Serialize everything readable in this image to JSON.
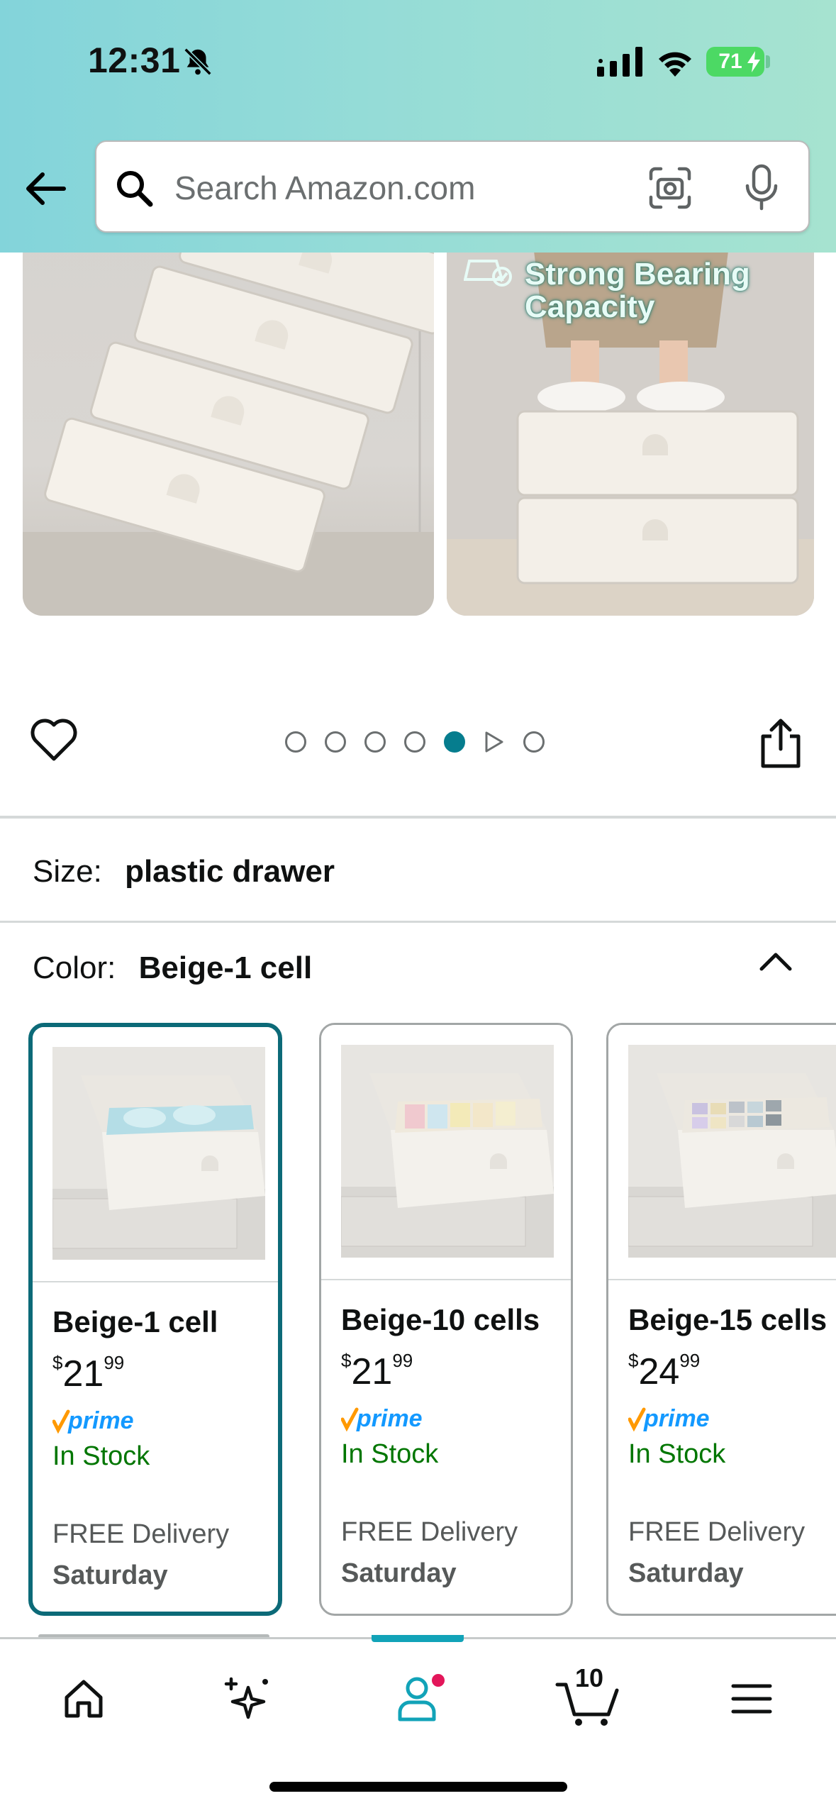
{
  "status_bar": {
    "time": "12:31",
    "battery": "71",
    "icons": [
      "bell-slash-icon",
      "cellular-signal-icon",
      "wifi-icon",
      "battery-charging-icon"
    ]
  },
  "header": {
    "back_icon": "arrow-left-icon",
    "search": {
      "placeholder": "Search Amazon.com",
      "value": ""
    },
    "camera_icon": "camera-scan-icon",
    "mic_icon": "microphone-icon",
    "gradient_colors": [
      "#83d4da",
      "#a6e3d0"
    ]
  },
  "gallery": {
    "right_image_caption": "Strong Bearing Capacity",
    "dots_total": 7,
    "active_dot_index": 4,
    "video_dot_index": 5,
    "active_color": "#067d8e"
  },
  "options": {
    "size": {
      "label": "Size:",
      "value": "plastic drawer"
    },
    "color": {
      "label": "Color:",
      "value": "Beige-1 cell"
    }
  },
  "color_cards": [
    {
      "name": "Beige-1 cell",
      "price_currency": "$",
      "price_whole": "21",
      "price_cents": "99",
      "prime": "prime",
      "stock": "In Stock",
      "delivery": "FREE Delivery",
      "delivery_day": "Saturday",
      "selected": true
    },
    {
      "name": "Beige-10 cells",
      "price_currency": "$",
      "price_whole": "21",
      "price_cents": "99",
      "prime": "prime",
      "stock": "In Stock",
      "delivery": "FREE Delivery",
      "delivery_day": "Saturday",
      "selected": false
    },
    {
      "name": "Beige-15 cells",
      "price_currency": "$",
      "price_whole": "24",
      "price_cents": "99",
      "prime": "prime",
      "stock": "In Stock",
      "delivery": "FREE Delivery",
      "delivery_day": "Saturday",
      "selected": false
    }
  ],
  "bottom_nav": {
    "items": [
      "home-icon",
      "ai-sparkle-icon",
      "account-icon",
      "cart-icon",
      "menu-icon"
    ],
    "active": "account-icon",
    "cart_count": "10"
  }
}
